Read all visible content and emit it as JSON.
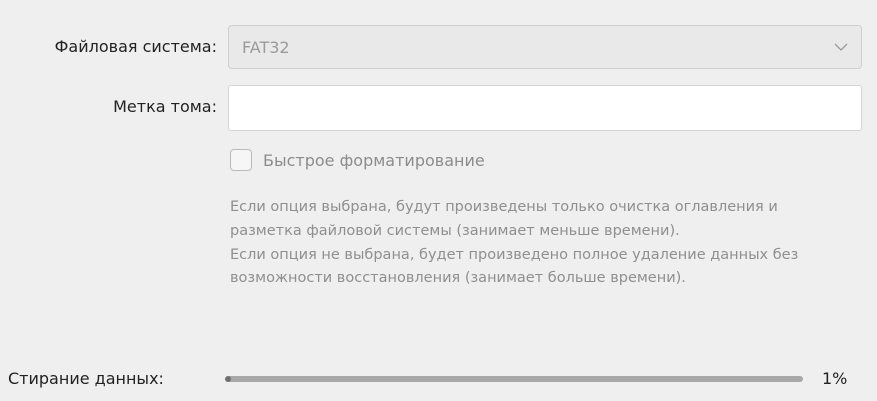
{
  "filesystem": {
    "label": "Файловая система:",
    "selected": "FAT32"
  },
  "volume_label": {
    "label": "Метка тома:",
    "value": ""
  },
  "quick_format": {
    "label": "Быстрое форматирование",
    "checked": false
  },
  "help": {
    "paragraph1": "Если опция выбрана, будут произведены только очистка оглавления и разметка файловой системы (занимает меньше времени).",
    "paragraph2": "Если опция не выбрана, будет произведено полное удаление данных без возможности восстановления (занимает больше времени)."
  },
  "erase": {
    "label": "Стирание данных:",
    "progress_percent": 1,
    "progress_text": "1%"
  }
}
